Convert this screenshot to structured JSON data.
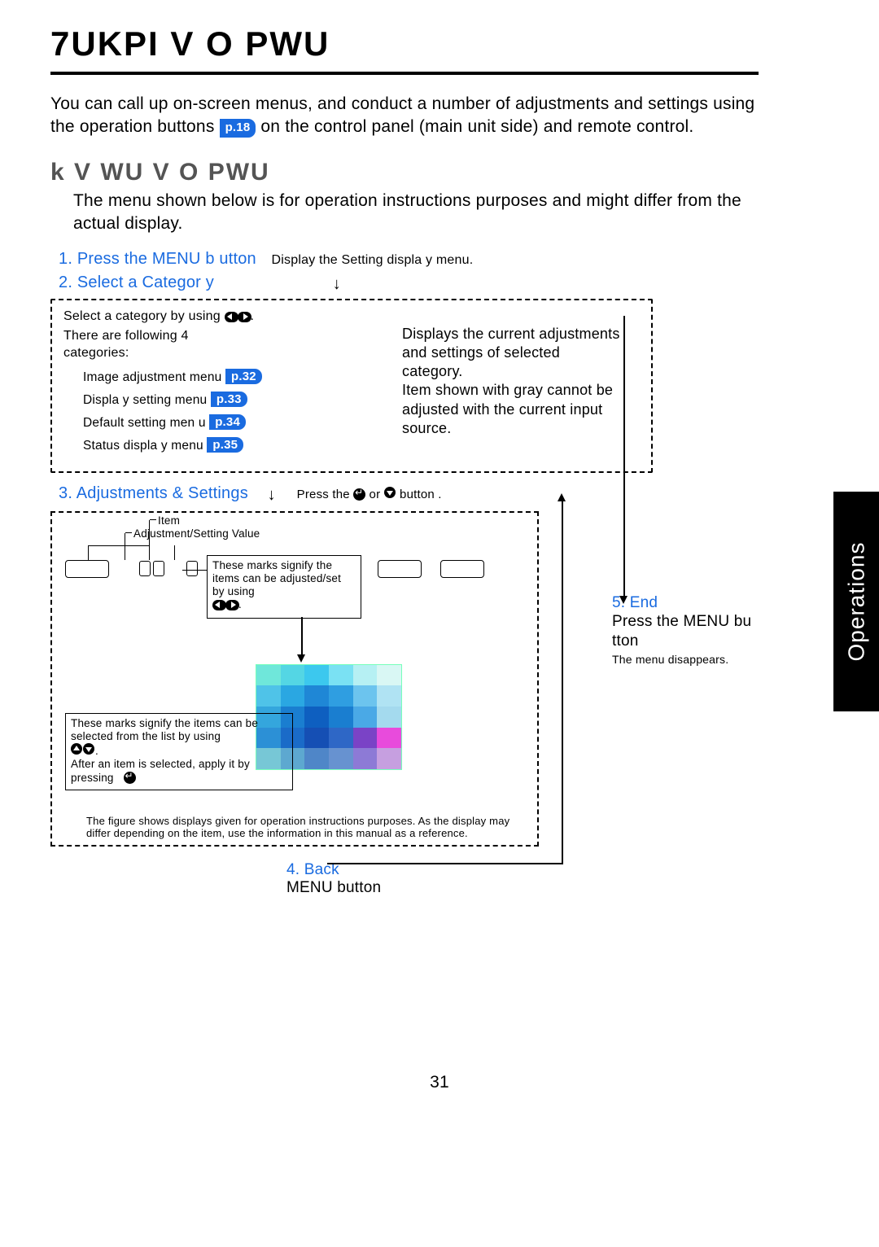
{
  "title": "7UKPI V   O  PWU",
  "intro_a": "You can call up on-screen menus, and conduct a number of adjustments and settings using the operation buttons ",
  "intro_ref": "p.18",
  "intro_b": " on the control panel (main unit side) and remote control.",
  "subtitle": "k      V  WU  V   O  PWU",
  "subdesc": "The menu shown below is for operation instructions purposes and might differ from the actual display.",
  "step1": "1. Press the MENU b utton",
  "step1_desc": "Display the Setting displa y menu.",
  "step2": "2. Select a Categor y",
  "cat_desc_a": "Select a category by using ",
  "cat_desc_b": ".",
  "cat_note": "There are following 4 categories:",
  "cat1": "Image adjustment  menu",
  "cat1_ref": "p.32",
  "cat2": "Displa y setting  menu",
  "cat2_ref": "p.33",
  "cat3": "Default setting men u",
  "cat3_ref": "p.34",
  "cat4": "Status displa y menu",
  "cat4_ref": "p.35",
  "right_note1": "Displays the current adjustments and settings of selected category.\nItem shown with gray cannot be adjusted with the current input source.",
  "step3": "3. Adjustments & Settings",
  "step3_desc_a": "Press the ",
  "step3_desc_b": " or ",
  "step3_desc_c": " button .",
  "d_item": "Item",
  "d_av": "Adjustment/Setting Value",
  "callout1_a": "These marks signify the items can be adjusted/set by using",
  "callout1_b": ".",
  "callout2_a": "These marks signify the items can be selected from the list by using",
  "callout2_b": ".",
  "callout2_c": "After an item is selected, apply it by pressing",
  "foot_note": "The figure shows displays given for operation instructions purposes.  As the display may differ depending on the item, use the information in this manual as a reference.",
  "step4": "4. Back",
  "step4_sub": "MENU button",
  "step5_title": "5. End",
  "step5_desc": "Press the MENU bu tton",
  "step5_note": "The menu disappears.",
  "side_tab": "Operations",
  "page_num": "31"
}
